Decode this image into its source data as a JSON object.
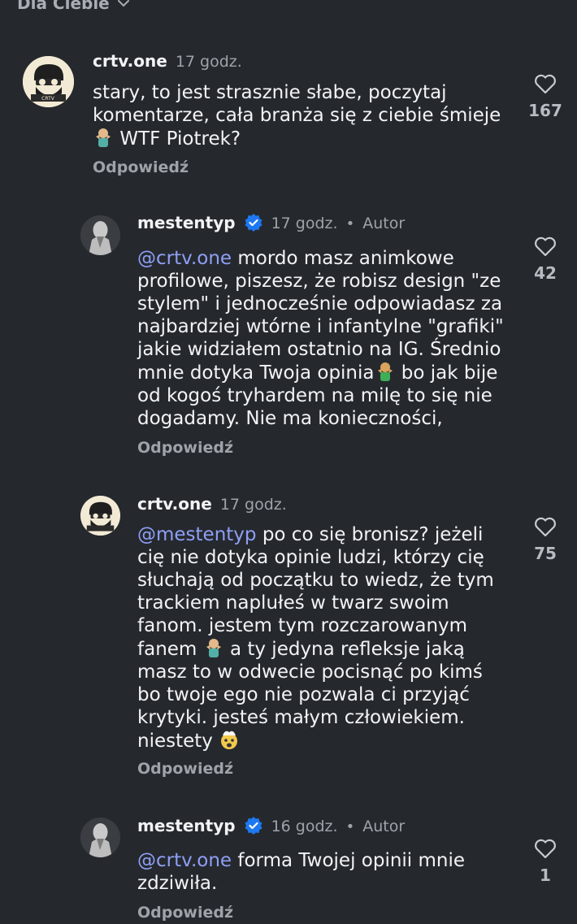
{
  "header": {
    "title": "Dla Ciebie"
  },
  "comments": [
    {
      "user": "crtv.one",
      "time": "17 godz.",
      "line1": "stary, to jest strasznie słabe, poczytaj",
      "line2": "komentarze, cała branża się z ciebie śmieje",
      "line3": "WTF Piotrek?",
      "reply": "Odpowiedź",
      "likes": "167"
    },
    {
      "user": "mestentyp",
      "time": "17 godz.",
      "author": "Autor",
      "mention": "@crtv.one",
      "line1": " mordo masz animkowe",
      "line2": "profilowe, piszesz, że robisz design \"ze",
      "line3": "stylem\" i jednocześnie odpowiadasz za",
      "line4": "najbardziej wtórne i infantylne \"grafiki\"",
      "line5": "jakie widziałem ostatnio na IG. Średnio",
      "line6a": "mnie dotyka Twoja opinia",
      "line6b": " bo jak bije",
      "line7": "od kogoś tryhardem na milę to się nie",
      "line8": "dogadamy. Nie ma konieczności,",
      "reply": "Odpowiedź",
      "likes": "42"
    },
    {
      "user": "crtv.one",
      "time": "17 godz.",
      "mention": "@mestentyp",
      "line1": " po co się bronisz? jeżeli",
      "line2": "cię nie dotyka opinie ludzi, którzy cię",
      "line3": "słuchają od początku to wiedz, że tym",
      "line4": "trackiem naplułeś w twarz swoim",
      "line5": "fanom. jestem tym rozczarowanym",
      "line6a": "fanem ",
      "line6b": " a ty jedyna refleksje jaką",
      "line7": "masz to w odwecie pocisnąć po kimś",
      "line8": "bo twoje ego nie pozwala ci przyjąć",
      "line9": "krytyki. jesteś małym człowiekiem.",
      "line10": "niestety ",
      "reply": "Odpowiedź",
      "likes": "75"
    },
    {
      "user": "mestentyp",
      "time": "16 godz.",
      "author": "Autor",
      "mention": "@crtv.one",
      "line1": " forma Twojej opinii mnie",
      "line2": "zdziwiła.",
      "reply": "Odpowiedź",
      "likes": "1"
    }
  ],
  "colors": {
    "background": "#25292e",
    "mention": "#8f9ff5",
    "verified": "#1d78f2",
    "muted": "#9ea3aa"
  },
  "icons": {
    "like": "heart-outline-icon",
    "verified": "verified-badge-icon",
    "dropdown": "chevron-down-icon"
  }
}
